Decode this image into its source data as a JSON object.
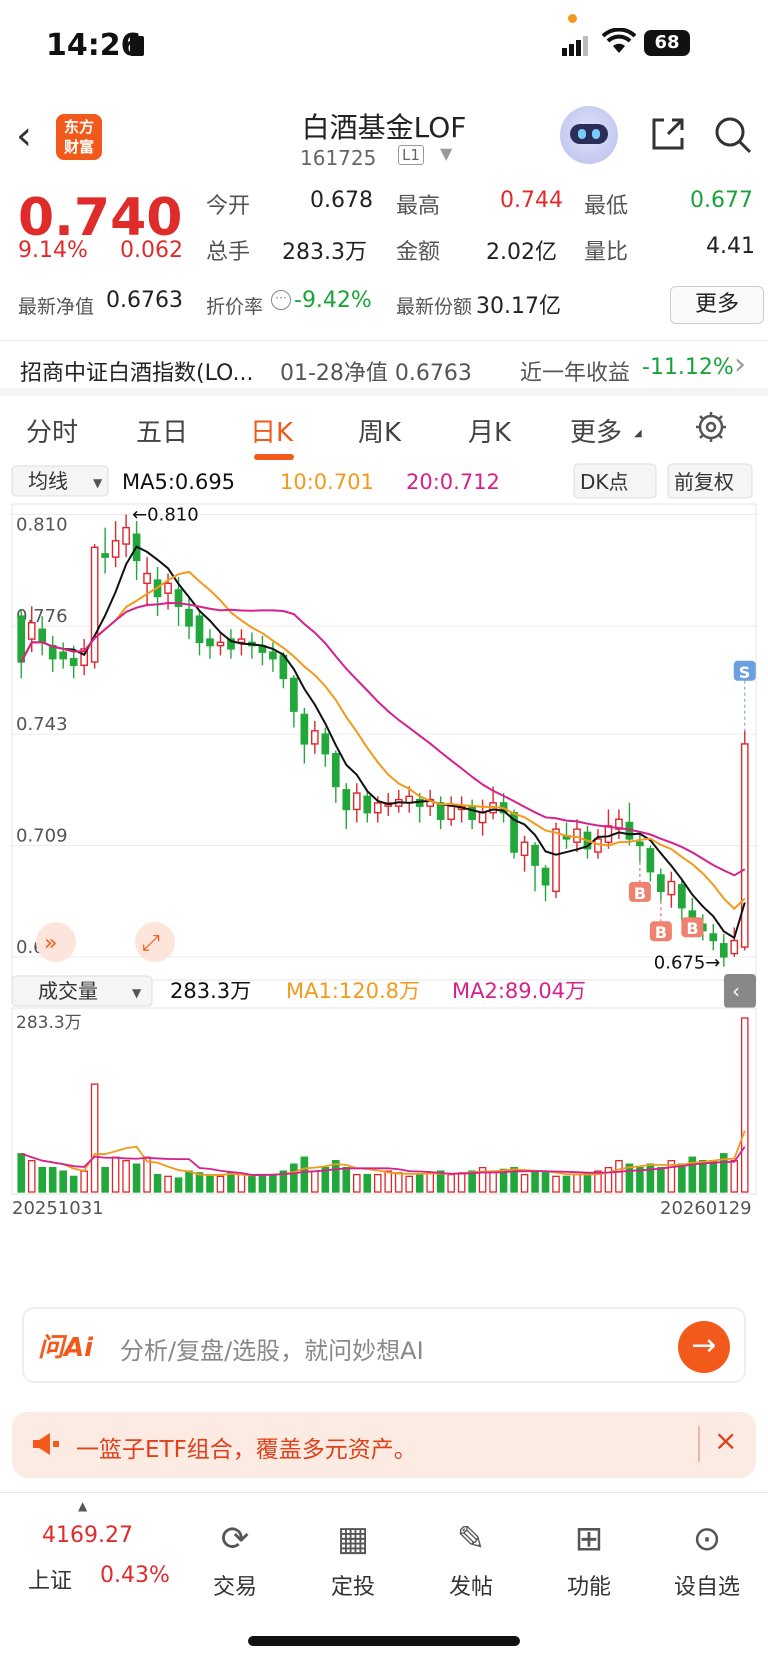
{
  "status": {
    "time": "14:26",
    "battery": "68"
  },
  "nav": {
    "title": "白酒基金LOF",
    "code": "161725",
    "level": "L1"
  },
  "quote": {
    "price": "0.740",
    "change_pct": "9.14%",
    "change": "0.062",
    "fields": [
      {
        "label": "今开",
        "value": "0.678",
        "color": "dark"
      },
      {
        "label": "最高",
        "value": "0.744",
        "color": "red"
      },
      {
        "label": "最低",
        "value": "0.677",
        "color": "green"
      },
      {
        "label": "总手",
        "value": "283.3万",
        "color": "dark"
      },
      {
        "label": "金额",
        "value": "2.02亿",
        "color": "dark"
      },
      {
        "label": "量比",
        "value": "4.41",
        "color": "dark"
      }
    ],
    "nav_label": "最新净值",
    "nav_value": "0.6763",
    "discount_label": "折价率",
    "discount_value": "-9.42%",
    "shares_label": "最新份额",
    "shares_value": "30.17亿",
    "more": "更多"
  },
  "index_row": {
    "name": "招商中证白酒指数(LO...",
    "nav_text": "01-28净值 0.6763",
    "return_label": "近一年收益",
    "return_value": "-11.12%"
  },
  "tabs": [
    "分时",
    "五日",
    "日K",
    "周K",
    "月K",
    "更多"
  ],
  "active_tab": "日K",
  "chart_data": {
    "type": "candlestick",
    "ma_toggle": "均线",
    "ma5": "MA5:0.695",
    "ma10": "10:0.701",
    "ma20": "20:0.712",
    "dk_button": "DK点",
    "adjust_button": "前复权",
    "y_ticks": [
      "0.810",
      "0.776",
      "0.743",
      "0.709",
      "0.675"
    ],
    "max_label": "0.810",
    "min_label": "0.675",
    "signals": [
      "B",
      "B",
      "B",
      "S"
    ],
    "volume_toggle": "成交量",
    "volume_value": "283.3万",
    "vol_ma1": "MA1:120.8万",
    "vol_ma2": "MA2:89.04万",
    "volume_max_label": "283.3万",
    "date_start": "20251031",
    "date_end": "20260129",
    "ma_colors": {
      "ma5": "#111111",
      "ma10": "#f39a1a",
      "ma20": "#d6218c"
    },
    "candles": [
      [
        0.779,
        0.765,
        0.781,
        0.76
      ],
      [
        0.772,
        0.777,
        0.782,
        0.768
      ],
      [
        0.775,
        0.771,
        0.779,
        0.767
      ],
      [
        0.77,
        0.766,
        0.773,
        0.762
      ],
      [
        0.768,
        0.766,
        0.771,
        0.763
      ],
      [
        0.766,
        0.764,
        0.77,
        0.76
      ],
      [
        0.764,
        0.769,
        0.772,
        0.761
      ],
      [
        0.765,
        0.8,
        0.801,
        0.763
      ],
      [
        0.798,
        0.797,
        0.806,
        0.792
      ],
      [
        0.797,
        0.802,
        0.808,
        0.794
      ],
      [
        0.801,
        0.806,
        0.81,
        0.797
      ],
      [
        0.804,
        0.796,
        0.808,
        0.79
      ],
      [
        0.789,
        0.792,
        0.797,
        0.782
      ],
      [
        0.79,
        0.785,
        0.794,
        0.779
      ],
      [
        0.786,
        0.789,
        0.792,
        0.781
      ],
      [
        0.787,
        0.782,
        0.791,
        0.776
      ],
      [
        0.781,
        0.776,
        0.785,
        0.772
      ],
      [
        0.779,
        0.771,
        0.781,
        0.767
      ],
      [
        0.772,
        0.77,
        0.775,
        0.766
      ],
      [
        0.77,
        0.771,
        0.774,
        0.767
      ],
      [
        0.772,
        0.769,
        0.775,
        0.766
      ],
      [
        0.771,
        0.772,
        0.775,
        0.767
      ],
      [
        0.771,
        0.77,
        0.774,
        0.766
      ],
      [
        0.77,
        0.768,
        0.773,
        0.764
      ],
      [
        0.768,
        0.766,
        0.771,
        0.762
      ],
      [
        0.767,
        0.76,
        0.768,
        0.757
      ],
      [
        0.76,
        0.75,
        0.761,
        0.745
      ],
      [
        0.749,
        0.74,
        0.751,
        0.734
      ],
      [
        0.74,
        0.744,
        0.747,
        0.737
      ],
      [
        0.743,
        0.737,
        0.745,
        0.733
      ],
      [
        0.737,
        0.727,
        0.738,
        0.722
      ],
      [
        0.726,
        0.72,
        0.728,
        0.714
      ],
      [
        0.72,
        0.725,
        0.728,
        0.716
      ],
      [
        0.724,
        0.719,
        0.726,
        0.716
      ],
      [
        0.719,
        0.722,
        0.724,
        0.716
      ],
      [
        0.721,
        0.722,
        0.725,
        0.718
      ],
      [
        0.721,
        0.723,
        0.726,
        0.719
      ],
      [
        0.722,
        0.724,
        0.727,
        0.719
      ],
      [
        0.723,
        0.721,
        0.725,
        0.716
      ],
      [
        0.721,
        0.723,
        0.726,
        0.718
      ],
      [
        0.722,
        0.717,
        0.724,
        0.714
      ],
      [
        0.717,
        0.721,
        0.724,
        0.715
      ],
      [
        0.72,
        0.721,
        0.724,
        0.716
      ],
      [
        0.721,
        0.717,
        0.723,
        0.714
      ],
      [
        0.716,
        0.719,
        0.723,
        0.712
      ],
      [
        0.719,
        0.722,
        0.727,
        0.717
      ],
      [
        0.722,
        0.719,
        0.725,
        0.716
      ],
      [
        0.719,
        0.707,
        0.72,
        0.705
      ],
      [
        0.706,
        0.71,
        0.712,
        0.701
      ],
      [
        0.709,
        0.703,
        0.71,
        0.695
      ],
      [
        0.702,
        0.697,
        0.703,
        0.692
      ],
      [
        0.695,
        0.714,
        0.716,
        0.693
      ],
      [
        0.712,
        0.711,
        0.716,
        0.708
      ],
      [
        0.71,
        0.714,
        0.717,
        0.707
      ],
      [
        0.713,
        0.708,
        0.715,
        0.705
      ],
      [
        0.707,
        0.711,
        0.714,
        0.705
      ],
      [
        0.71,
        0.715,
        0.72,
        0.708
      ],
      [
        0.714,
        0.717,
        0.72,
        0.711
      ],
      [
        0.716,
        0.711,
        0.722,
        0.709
      ],
      [
        0.71,
        0.709,
        0.713,
        0.704
      ],
      [
        0.708,
        0.701,
        0.709,
        0.698
      ],
      [
        0.7,
        0.695,
        0.702,
        0.692
      ],
      [
        0.694,
        0.698,
        0.701,
        0.69
      ],
      [
        0.697,
        0.69,
        0.699,
        0.686
      ],
      [
        0.689,
        0.686,
        0.693,
        0.681
      ],
      [
        0.685,
        0.683,
        0.688,
        0.68
      ],
      [
        0.682,
        0.68,
        0.685,
        0.677
      ],
      [
        0.679,
        0.675,
        0.682,
        0.672
      ],
      [
        0.676,
        0.68,
        0.684,
        0.675
      ],
      [
        0.678,
        0.74,
        0.744,
        0.677
      ]
    ],
    "volumes": [
      22,
      18,
      14,
      14,
      12,
      9,
      12,
      62,
      14,
      20,
      18,
      16,
      20,
      10,
      9,
      8,
      12,
      11,
      9,
      9,
      11,
      10,
      9,
      10,
      10,
      12,
      16,
      20,
      12,
      14,
      18,
      14,
      10,
      10,
      10,
      12,
      11,
      9,
      10,
      11,
      12,
      10,
      11,
      12,
      14,
      12,
      13,
      14,
      10,
      12,
      11,
      9,
      9,
      10,
      11,
      12,
      14,
      18,
      16,
      14,
      16,
      14,
      18,
      16,
      20,
      18,
      18,
      22,
      18,
      100
    ]
  },
  "ai": {
    "logo": "问Ai",
    "placeholder": "分析/复盘/选股，就问妙想AI"
  },
  "notice": {
    "text": "一篮子ETF组合，覆盖多元资产。"
  },
  "bottom_nav": {
    "index_value": "4169.27",
    "index_name": "上证",
    "index_change": "0.43%",
    "items": [
      {
        "icon": "trade-icon",
        "label": "交易"
      },
      {
        "icon": "invest-icon",
        "label": "定投"
      },
      {
        "icon": "post-icon",
        "label": "发帖"
      },
      {
        "icon": "functions-icon",
        "label": "功能"
      },
      {
        "icon": "watchlist-icon",
        "label": "设自选"
      }
    ]
  }
}
